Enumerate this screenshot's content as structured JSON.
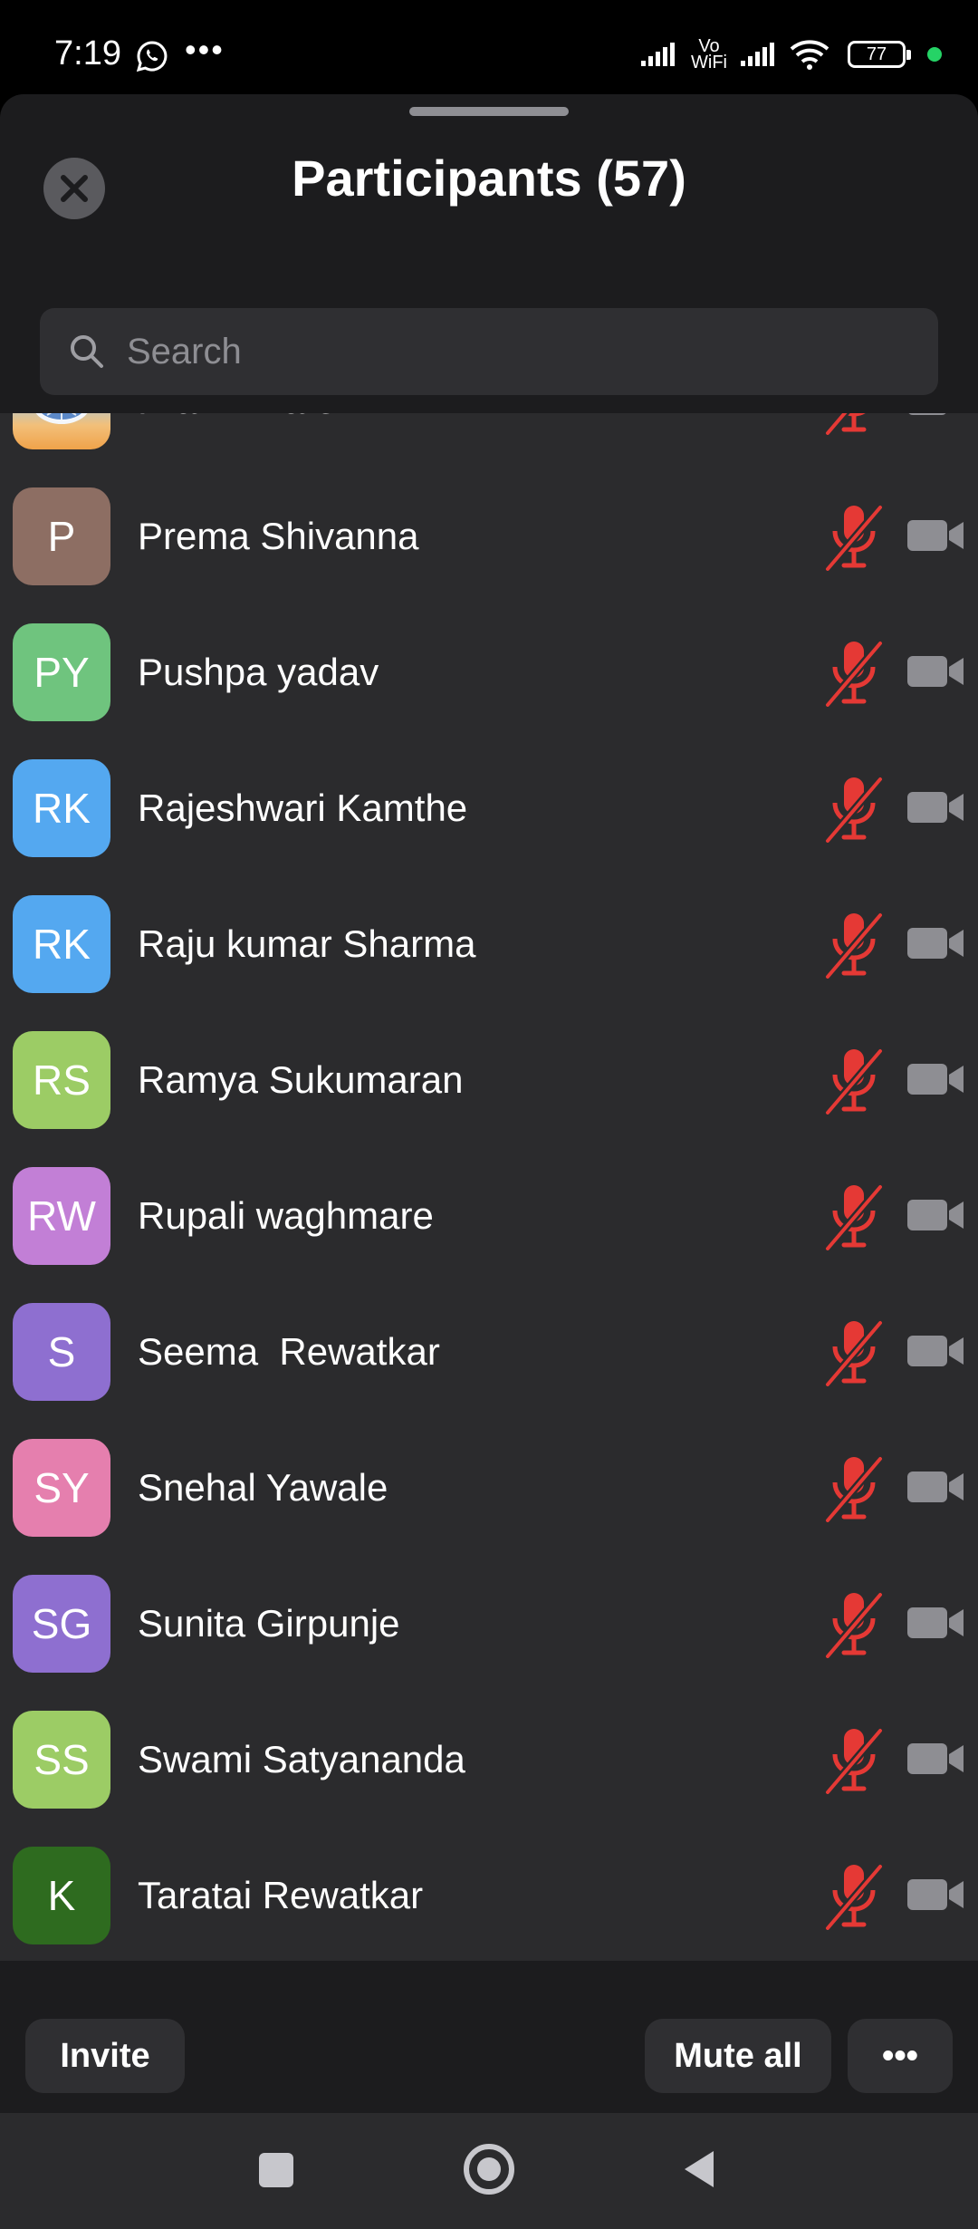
{
  "status_bar": {
    "time": "7:19",
    "network_label_top": "Vo",
    "network_label_bottom": "WiFi",
    "battery": "77",
    "icons": [
      "whatsapp-icon",
      "more-dots-icon",
      "signal-icon",
      "signal-icon",
      "wifi-icon",
      "battery-icon"
    ]
  },
  "header": {
    "title": "Participants (57)"
  },
  "search": {
    "placeholder": "Search"
  },
  "participants": [
    {
      "name": "Pravin Dafe",
      "initials": "",
      "avatar_type": "image",
      "color": "#e9a25a"
    },
    {
      "name": "Prema Shivanna",
      "initials": "P",
      "avatar_type": "initials",
      "color": "#8d6e63"
    },
    {
      "name": "Pushpa yadav",
      "initials": "PY",
      "avatar_type": "initials",
      "color": "#6fc47e"
    },
    {
      "name": "Rajeshwari Kamthe",
      "initials": "RK",
      "avatar_type": "initials",
      "color": "#54a8f0"
    },
    {
      "name": "Raju kumar Sharma",
      "initials": "RK",
      "avatar_type": "initials",
      "color": "#54a8f0"
    },
    {
      "name": "Ramya Sukumaran",
      "initials": "RS",
      "avatar_type": "initials",
      "color": "#9ccc65"
    },
    {
      "name": "Rupali waghmare",
      "initials": "RW",
      "avatar_type": "initials",
      "color": "#c27fd6"
    },
    {
      "name": "Seema  Rewatkar",
      "initials": "S",
      "avatar_type": "initials",
      "color": "#8e6fd0"
    },
    {
      "name": "Snehal Yawale",
      "initials": "SY",
      "avatar_type": "initials",
      "color": "#e57fae"
    },
    {
      "name": "Sunita Girpunje",
      "initials": "SG",
      "avatar_type": "initials",
      "color": "#8e6fd0"
    },
    {
      "name": "Swami Satyananda",
      "initials": "SS",
      "avatar_type": "initials",
      "color": "#9ccc65"
    },
    {
      "name": "Taratai Rewatkar",
      "initials": "K",
      "avatar_type": "initials",
      "color": "#2e6b1f"
    }
  ],
  "participant_status": {
    "mic": "muted-mic-icon",
    "video": "video-off-icon",
    "muted_color": "#e53935",
    "video_color": "#8e8e93"
  },
  "footer": {
    "invite_label": "Invite",
    "mute_all_label": "Mute all",
    "more_label": "•••"
  },
  "nav_bar": {
    "icons": [
      "recents-icon",
      "home-icon",
      "back-icon"
    ]
  }
}
